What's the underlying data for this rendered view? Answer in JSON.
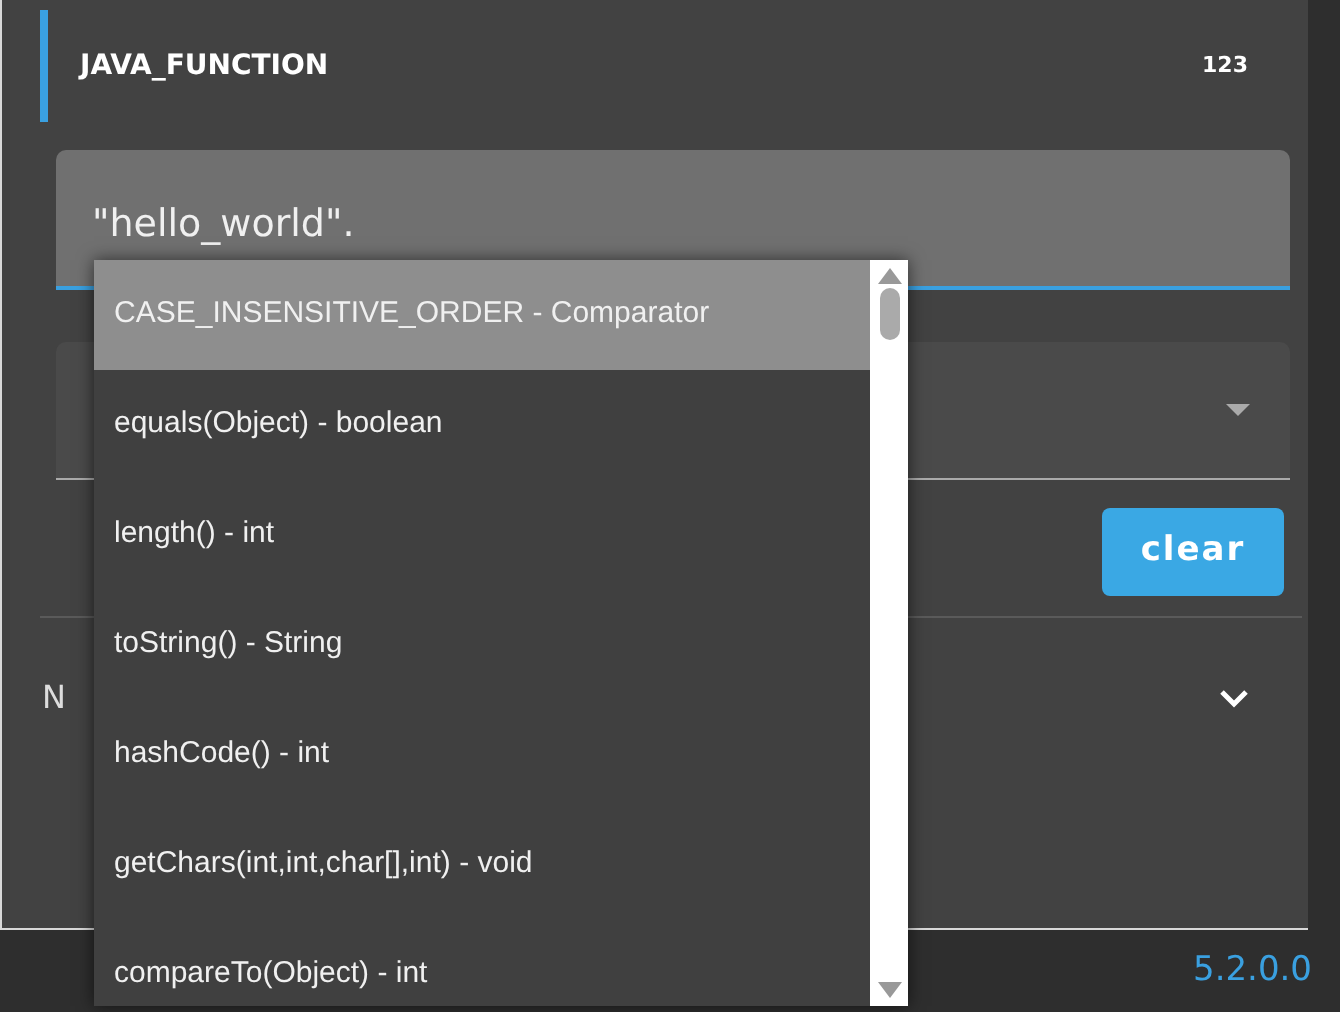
{
  "header": {
    "title": "JAVA_FUNCTION",
    "badge": "123"
  },
  "expression_input": {
    "value": "\"hello_world\"."
  },
  "autocomplete": [
    {
      "label": "CASE_INSENSITIVE_ORDER - Comparator",
      "selected": true
    },
    {
      "label": "equals(Object) - boolean",
      "selected": false
    },
    {
      "label": "length() - int",
      "selected": false
    },
    {
      "label": "toString() - String",
      "selected": false
    },
    {
      "label": "hashCode() - int",
      "selected": false
    },
    {
      "label": "getChars(int,int,char[],int) - void",
      "selected": false
    },
    {
      "label": "compareTo(Object) - int",
      "selected": false
    }
  ],
  "clear_button": "clear",
  "collapsed_section": {
    "label": "N",
    "expanded": false
  },
  "footer": {
    "version": "5.2.0.0"
  }
}
